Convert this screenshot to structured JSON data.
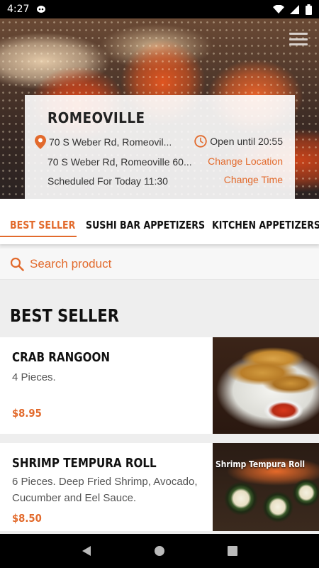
{
  "status_bar": {
    "time": "4:27",
    "icons": [
      "notification-icon",
      "wifi-icon",
      "signal-icon",
      "battery-icon"
    ]
  },
  "header": {
    "menu_icon": "hamburger-menu-icon"
  },
  "store": {
    "name": "ROMEOVILLE",
    "address_line1": "70 S Weber Rd, Romeovil...",
    "address_line2": "70 S Weber Rd, Romeoville 60...",
    "scheduled": "Scheduled For Today 11:30",
    "open_until": "Open until 20:55",
    "change_location": "Change Location",
    "change_time": "Change Time"
  },
  "tabs": [
    {
      "label": "BEST SELLER",
      "active": true
    },
    {
      "label": "SUSHI BAR APPETIZERS",
      "active": false
    },
    {
      "label": "KITCHEN APPETIZERS",
      "active": false
    }
  ],
  "search": {
    "placeholder": "Search product"
  },
  "section": {
    "title": "BEST SELLER"
  },
  "products": [
    {
      "name": "CRAB RANGOON",
      "description": "4 Pieces.",
      "price": "$8.95"
    },
    {
      "name": "SHRIMP TEMPURA ROLL",
      "description": "6 Pieces. Deep Fried Shrimp, Avocado, Cucumber and Eel Sauce.",
      "price": "$8.50",
      "image_caption": "Shrimp Tempura Roll"
    }
  ],
  "colors": {
    "accent": "#e26a2c",
    "text": "#111111",
    "background": "#eeeeee"
  }
}
